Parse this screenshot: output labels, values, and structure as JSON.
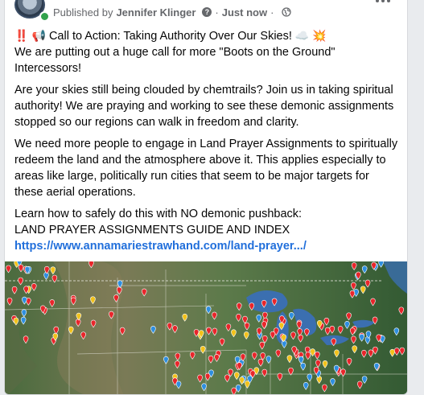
{
  "post": {
    "published_by_label": "Published by",
    "author": "Jennifer Klinger",
    "help_glyph": "?",
    "separator": "·",
    "time": "Just now",
    "audience_icon": "globe-icon",
    "title_prefix_emoji": "‼️",
    "megaphone_emoji": "📢",
    "title": "Call to Action: Taking Authority Over Our Skies!",
    "cloud_emoji": "☁️",
    "burst_emoji": "💥",
    "line1": "We are putting out a huge call for more \"Boots on the Ground\" Intercessors!",
    "para2": "Are your skies still being clouded by chemtrails? Join us in taking spiritual authority! We are praying and working to see these demonic assignments stopped so our regions can walk in freedom and clarity.",
    "para3": "We need more people to engage in Land Prayer Assignments to spiritually redeem the land and the atmosphere above it. This applies especially to areas like large, politically run cities that seem to be major targets for these aerial operations.",
    "learn_line": "Learn how to safely do this with NO demonic pushback:",
    "guide_line": "LAND PRAYER ASSIGNMENTS GUIDE AND INDEX",
    "link": "https://www.annamariestrawhand.com/land-prayer.../"
  },
  "colors": {
    "link": "#216fdb",
    "meta_text": "#65676b",
    "online": "#31a24c",
    "map_land": "#3f6a3a",
    "map_water": "#3b6fb0",
    "marker_red": "#e8262b",
    "marker_blue": "#2f8fe0",
    "marker_yellow": "#f2c21b"
  }
}
